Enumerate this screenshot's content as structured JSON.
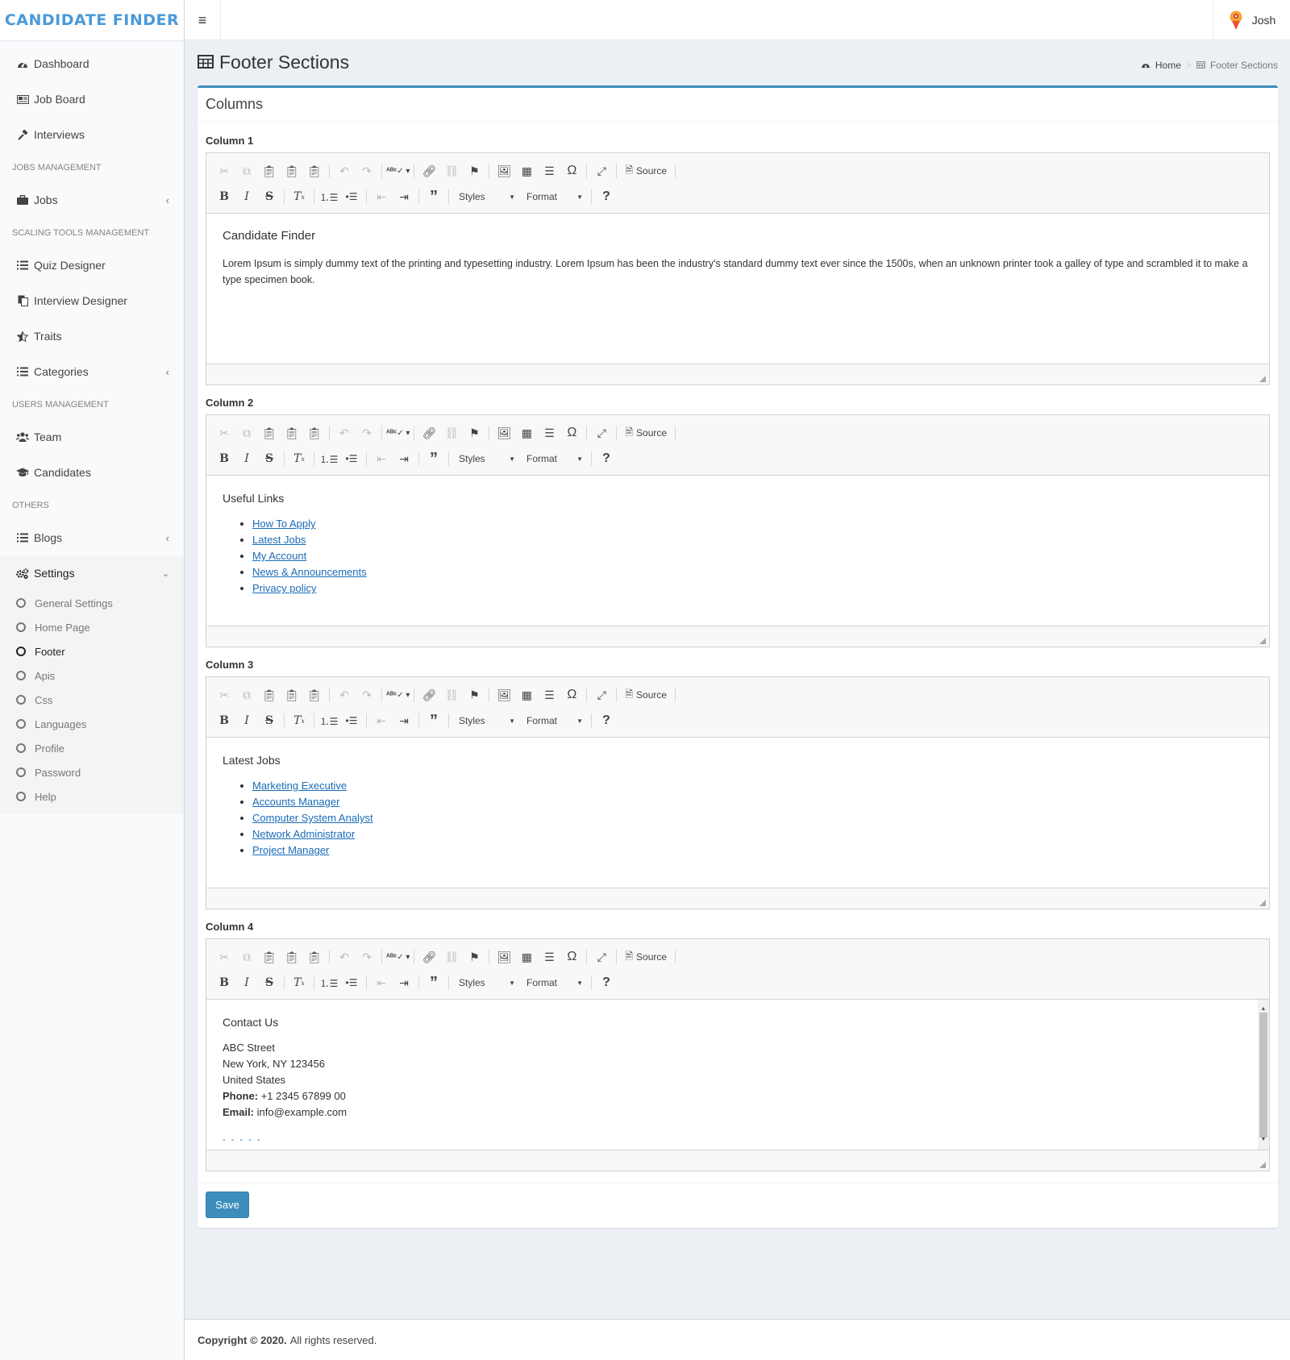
{
  "app": {
    "logo_text": "CANDIDATE FINDER",
    "accent": "#3c8dbc"
  },
  "topbar": {
    "user_name": "Josh"
  },
  "sidebar": {
    "items_top": [
      {
        "label": "Dashboard",
        "icon": "dashboard-icon"
      },
      {
        "label": "Job Board",
        "icon": "newspaper-icon"
      },
      {
        "label": "Interviews",
        "icon": "gavel-icon"
      }
    ],
    "headers": {
      "jobs": "JOBS MANAGEMENT",
      "scaling": "SCALING TOOLS MANAGEMENT",
      "users": "USERS MANAGEMENT",
      "others": "OTHERS"
    },
    "jobs_items": [
      {
        "label": "Jobs",
        "icon": "briefcase-icon"
      }
    ],
    "scaling_items": [
      {
        "label": "Quiz Designer",
        "icon": "list-icon"
      },
      {
        "label": "Interview Designer",
        "icon": "copy-icon"
      },
      {
        "label": "Traits",
        "icon": "star-half-icon"
      },
      {
        "label": "Categories",
        "icon": "list-icon"
      }
    ],
    "users_items": [
      {
        "label": "Team",
        "icon": "users-icon"
      },
      {
        "label": "Candidates",
        "icon": "graduation-cap-icon"
      }
    ],
    "others_items": [
      {
        "label": "Blogs",
        "icon": "list-icon"
      },
      {
        "label": "Settings",
        "icon": "cogs-icon"
      }
    ],
    "settings_sub": [
      "General Settings",
      "Home Page",
      "Footer",
      "Apis",
      "Css",
      "Languages",
      "Profile",
      "Password",
      "Help"
    ]
  },
  "page": {
    "title": "Footer Sections",
    "breadcrumb_home": "Home",
    "breadcrumb_current": "Footer Sections",
    "box_title": "Columns",
    "save_label": "Save"
  },
  "toolbar": {
    "source_label": "Source",
    "styles_label": "Styles",
    "format_label": "Format"
  },
  "columns": [
    {
      "label": "Column 1",
      "heading": "Candidate Finder",
      "paragraph": "Lorem Ipsum is simply dummy text of the printing and typesetting industry. Lorem Ipsum has been the industry's standard dummy text ever since the 1500s, when an unknown printer took a galley of type and scrambled it to make a type specimen book."
    },
    {
      "label": "Column 2",
      "heading": "Useful Links",
      "links": [
        "How To Apply",
        "Latest Jobs",
        "My Account",
        "News & Announcements",
        "Privacy policy"
      ]
    },
    {
      "label": "Column 3",
      "heading": "Latest Jobs",
      "links": [
        "Marketing Executive",
        "Accounts Manager",
        "Computer System Analyst",
        "Network Administrator",
        "Project Manager"
      ]
    },
    {
      "label": "Column 4",
      "heading": "Contact Us",
      "address": [
        "ABC Street",
        "New York, NY 123456",
        "United States"
      ],
      "phone_label": "Phone:",
      "phone": "+1 2345 67899 00",
      "email_label": "Email:",
      "email": "info@example.com",
      "dashed": "- - - - -"
    }
  ],
  "footer": {
    "copyright": "Copyright © 2020.",
    "rights": "All rights reserved."
  }
}
